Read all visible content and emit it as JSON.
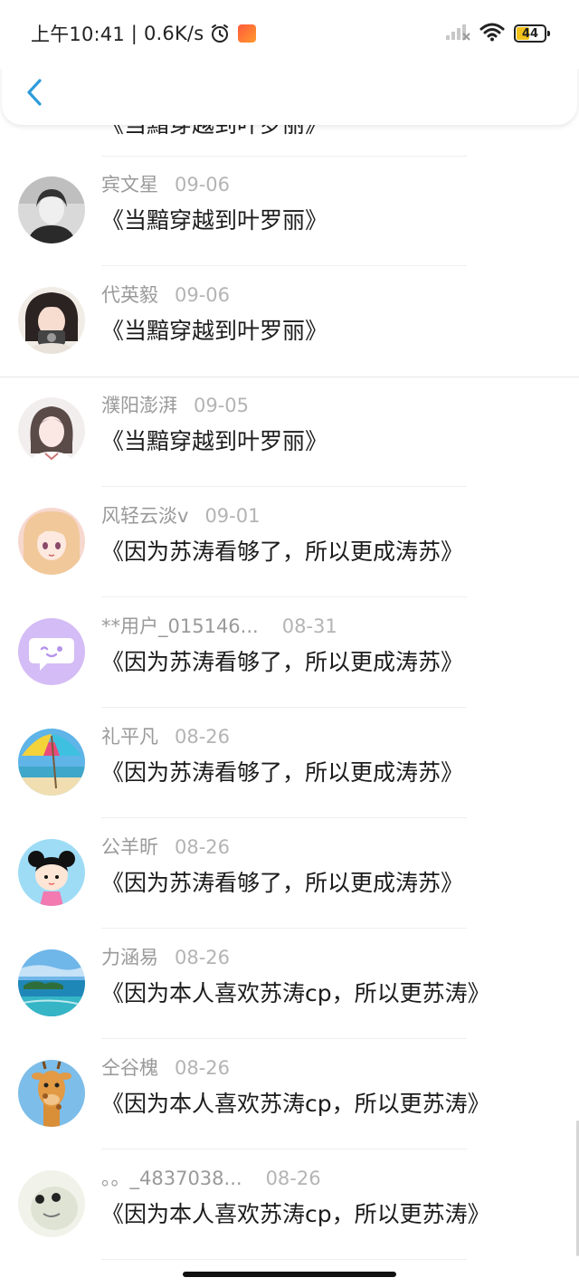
{
  "status_bar": {
    "time": "上午10:41",
    "network_speed": "0.6K/s",
    "battery": "44",
    "icons": [
      "alarm-icon",
      "app-badge-icon",
      "signal-icon",
      "wifi-icon",
      "battery-icon"
    ]
  },
  "header": {
    "back_icon": "chevron-left-icon",
    "accent_color": "#2d9cdb"
  },
  "partial_item": {
    "message": "《当黯穿越到叶罗丽》"
  },
  "items": [
    {
      "name": "宾文星",
      "date": "09-06",
      "message": "《当黯穿越到叶罗丽》",
      "avatar": "grayscale-portrait"
    },
    {
      "name": "代英毅",
      "date": "09-06",
      "message": "《当黯穿越到叶罗丽》",
      "avatar": "girl-with-camera"
    },
    {
      "name": "濮阳澎湃",
      "date": "09-05",
      "message": "《当黯穿越到叶罗丽》",
      "avatar": "girl-portrait"
    },
    {
      "name": "风轻云淡v",
      "date": "09-01",
      "message": "《因为苏涛看够了，所以更成涛苏》",
      "avatar": "anime-girl"
    },
    {
      "name": "**用户_015146...",
      "date": "08-31",
      "message": "《因为苏涛看够了，所以更成涛苏》",
      "avatar": "default-purple-chat"
    },
    {
      "name": "礼平凡",
      "date": "08-26",
      "message": "《因为苏涛看够了，所以更成涛苏》",
      "avatar": "beach-umbrella"
    },
    {
      "name": "公羊昕",
      "date": "08-26",
      "message": "《因为苏涛看够了，所以更成涛苏》",
      "avatar": "cartoon-girl"
    },
    {
      "name": "力涵易",
      "date": "08-26",
      "message": "《因为本人喜欢苏涛cp，所以更苏涛》",
      "avatar": "island-sea"
    },
    {
      "name": "仝谷槐",
      "date": "08-26",
      "message": "《因为本人喜欢苏涛cp，所以更苏涛》",
      "avatar": "giraffe"
    },
    {
      "name": "。。_4837038...",
      "date": "08-26",
      "message": "《因为本人喜欢苏涛cp，所以更苏涛》",
      "avatar": "meme-face"
    }
  ]
}
